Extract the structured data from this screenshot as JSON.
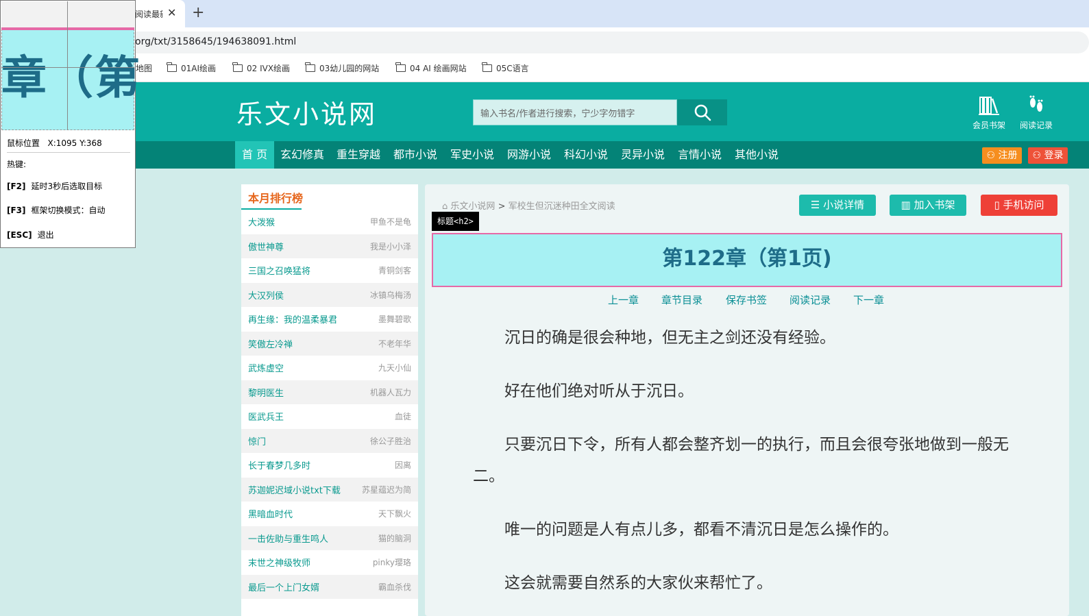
{
  "browser": {
    "tab_title": "阅读最新",
    "tab_close": "✕",
    "new_tab": "+",
    "url": "org/txt/3158645/194638091.html",
    "bookmarks": [
      "地图",
      "01AI绘画",
      "02 IVX绘画",
      "03幼儿园的网站",
      "04 AI 绘画网站",
      "05C语言"
    ]
  },
  "header": {
    "logo": "乐文小说网",
    "search_placeholder": "输入书名/作者进行搜索，宁少字勿错字",
    "icons": [
      {
        "label": "会员书架",
        "icon": "bookshelf-icon"
      },
      {
        "label": "阅读记录",
        "icon": "footprints-icon"
      }
    ]
  },
  "nav": {
    "items": [
      "首 页",
      "玄幻修真",
      "重生穿越",
      "都市小说",
      "军史小说",
      "网游小说",
      "科幻小说",
      "灵异小说",
      "言情小说",
      "其他小说"
    ],
    "register": "注册",
    "login": "登录"
  },
  "sidebar": {
    "title": "本月排行榜",
    "rows": [
      {
        "name": "大泼猴",
        "author": "甲鱼不是龟"
      },
      {
        "name": "傲世神尊",
        "author": "我是小小泽"
      },
      {
        "name": "三国之召唤猛将",
        "author": "青铜剑客"
      },
      {
        "name": "大汉列侯",
        "author": "冰镇乌梅汤"
      },
      {
        "name": "再生缘：我的温柔暴君",
        "author": "墨舞碧歌"
      },
      {
        "name": "笑傲左冷禅",
        "author": "不老年华"
      },
      {
        "name": "武炼虚空",
        "author": "九天小仙"
      },
      {
        "name": "黎明医生",
        "author": "机器人瓦力"
      },
      {
        "name": "医武兵王",
        "author": "血徒"
      },
      {
        "name": "惊门",
        "author": "徐公子胜治"
      },
      {
        "name": "长于春梦几多时",
        "author": "因离"
      },
      {
        "name": "苏迦妮迟域小说txt下载",
        "author": "苏星蕴迟为简"
      },
      {
        "name": "黑暗血时代",
        "author": "天下飘火"
      },
      {
        "name": "一击佐助与重生鸣人",
        "author": "猫的脑洞"
      },
      {
        "name": "末世之神级牧师",
        "author": "pinky璎珞"
      },
      {
        "name": "最后一个上门女婿",
        "author": "霸血杀伐"
      }
    ]
  },
  "content": {
    "breadcrumb_home": "乐文小说网",
    "breadcrumb_sep": ">",
    "breadcrumb_book": "军校生但沉迷种田全文阅读",
    "buttons": {
      "detail": "小说详情",
      "shelf": "加入书架",
      "mobile": "手机访问"
    },
    "chapter_title": "第122章（第1页)",
    "chapter_links": [
      "上一章",
      "章节目录",
      "保存书签",
      "阅读记录",
      "下一章"
    ],
    "paragraphs": [
      "沉日的确是很会种地，但无主之剑还没有经验。",
      "好在他们绝对听从于沉日。",
      "只要沉日下令，所有人都会整齐划一的执行，而且会很夸张地做到一般无二。",
      "唯一的问题是人有点儿多，都看不清沉日是怎么操作的。",
      "这会就需要自然系的大家伙来帮忙了。"
    ],
    "element_tag": "标题<h2>"
  },
  "tool": {
    "zoom_text": "章（第",
    "mouse_label": "鼠标位置",
    "mouse_pos": "X:1095 Y:368",
    "hotkeys_title": "热键:",
    "hotkeys": [
      {
        "key": "[F2]",
        "desc": "延时3秒后选取目标"
      },
      {
        "key": "[F3]",
        "desc": "框架切换模式：自动"
      },
      {
        "key": "[ESC]",
        "desc": "退出"
      }
    ]
  },
  "colors": {
    "teal": "#0aada1",
    "nav": "#048377",
    "orange": "#f68e1f",
    "red": "#ee5238",
    "highlight": "#a7f1f3",
    "pink": "#e669a7"
  }
}
